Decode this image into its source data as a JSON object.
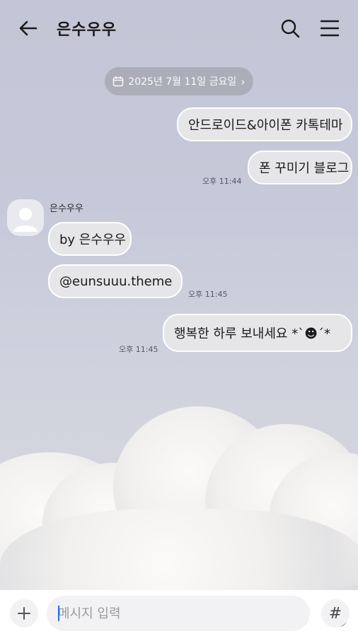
{
  "header": {
    "title": "은수우우",
    "back_icon": "arrow-left-icon",
    "search_icon": "search-icon",
    "menu_icon": "hamburger-menu-icon"
  },
  "date_chip": {
    "label": "2025년 7월 11일 금요일",
    "chevron": "›"
  },
  "messages": {
    "sent_1": {
      "text": "안드로이드&아이폰 카톡테마"
    },
    "sent_2": {
      "text": "폰 꾸미기 블로그",
      "time": "오후 11:44"
    },
    "received_sender": "은수우우",
    "received_1": {
      "text": "by 은수우우"
    },
    "received_2": {
      "text": "@eunsuuu.theme",
      "time": "오후 11:45"
    },
    "sent_3": {
      "text": "행복한 하루 보내세요 *ˋ☻ˊ*",
      "time": "오후 11:45"
    }
  },
  "composer": {
    "placeholder": "메시지 입력",
    "value": "",
    "plus_icon": "plus-icon",
    "emoji_icon": "smiley-icon",
    "hash_label": "#"
  },
  "colors": {
    "bubble_fill": "#e6e6e8",
    "bubble_border": "#ffffff",
    "chip_bg": "#a9abb6",
    "caret": "#2b6cf6"
  }
}
